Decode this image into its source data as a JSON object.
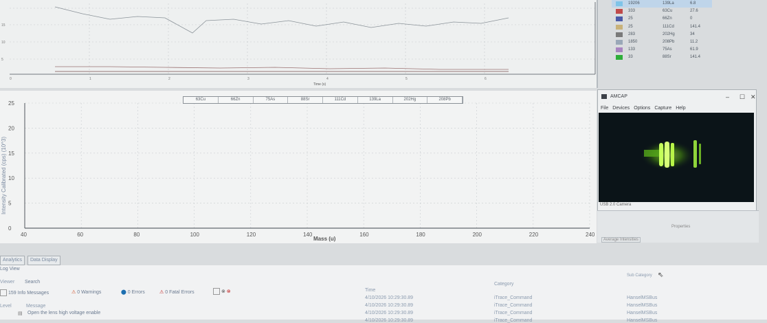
{
  "top_chart": {
    "y_ticks": [
      "15",
      "10",
      "5"
    ],
    "x_ticks": [
      "0",
      "1",
      "2",
      "3",
      "4",
      "5",
      "6"
    ],
    "x_label": "Time (s)"
  },
  "legend_table": {
    "rows": [
      {
        "color": "#7fc4e8",
        "c1": "19206",
        "c2": "139La",
        "c3": "6.8",
        "selected": true
      },
      {
        "color": "#c04a4a",
        "c1": "333",
        "c2": "63Cu",
        "c3": "27.6"
      },
      {
        "color": "#4a5aa8",
        "c1": "25",
        "c2": "66Zn",
        "c3": "0"
      },
      {
        "color": "#c9b27a",
        "c1": "25",
        "c2": "111Cd",
        "c3": "141.4"
      },
      {
        "color": "#7a7a7a",
        "c1": "283",
        "c2": "202Hg",
        "c3": "34"
      },
      {
        "color": "#9aa8b8",
        "c1": "1850",
        "c2": "208Pb",
        "c3": "11.2"
      },
      {
        "color": "#a884c0",
        "c1": "133",
        "c2": "75As",
        "c3": "61.9"
      },
      {
        "color": "#2fae3a",
        "c1": "33",
        "c2": "88Sr",
        "c3": "141.4"
      }
    ]
  },
  "main_chart": {
    "legend": [
      "63Cu",
      "66Zn",
      "75As",
      "88Sr",
      "111Cd",
      "139La",
      "202Hg",
      "208Pb"
    ],
    "ylabel": "Intensity Calibrated (cps) (10^3)",
    "xlabel": "Mass (u)"
  },
  "chart_data": {
    "type": "line",
    "x_ticks": [
      40,
      60,
      80,
      100,
      120,
      140,
      160,
      180,
      200,
      220,
      240
    ],
    "y_ticks": [
      0,
      5,
      10,
      15,
      20,
      25
    ],
    "xlim": [
      40,
      240
    ],
    "ylim": [
      0,
      25
    ],
    "xlabel": "Mass (u)",
    "ylabel": "Intensity Calibrated (cps) (10^3)",
    "series": []
  },
  "amcap": {
    "title": "AMCAP",
    "menu": [
      "File",
      "Devices",
      "Options",
      "Capture",
      "Help"
    ],
    "status": "USB 2.0 Camera",
    "minimize": "–",
    "maximize": "☐",
    "close": "✕"
  },
  "props_panel": {
    "properties_label": "Properties",
    "avg_label": "Average Intensities"
  },
  "tabs": {
    "analytics": "Analytics",
    "data_display": "Data Display"
  },
  "logview": {
    "title": "Log View",
    "viewer": "Viewer",
    "search": "Search",
    "info_messages": "159 Info Messages",
    "warnings": "0 Warnings",
    "errors": "0 Errors",
    "fatal_errors": "0 Fatal Errors",
    "col_level": "Level",
    "col_message": "Message",
    "col_time": "Time",
    "col_category": "Category",
    "col_subcategory": "Sub Category",
    "rows": [
      {
        "message": "Open the lens high voltage enable",
        "time": "4/10/2026 10:29:30.89",
        "category": "iTrace_Command",
        "subcategory": "HanselMSBus"
      },
      {
        "message": "",
        "time": "4/10/2026 10:29:30.89",
        "category": "iTrace_Command",
        "subcategory": "HanselMSBus"
      },
      {
        "message": "",
        "time": "4/10/2026 10:29:30.89",
        "category": "iTrace_Command",
        "subcategory": "HanselMSBus"
      },
      {
        "message": "",
        "time": "4/10/2026 10:29:30.89",
        "category": "iTrace_Command",
        "subcategory": "HanselMSBus"
      }
    ]
  }
}
